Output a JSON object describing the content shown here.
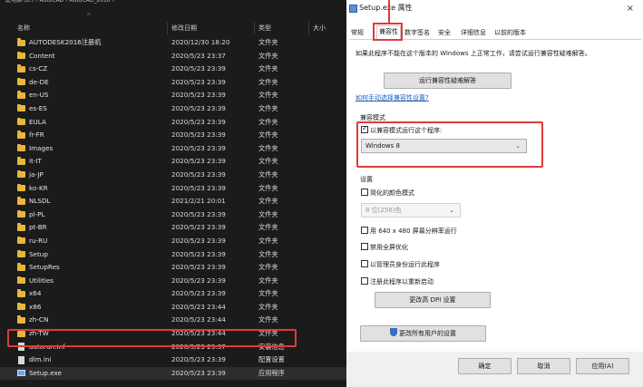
{
  "explorer": {
    "address_path": "此电脑 (D:) › AutoCAD › AutoCAD_2016 ›",
    "columns": {
      "name": "名称",
      "date": "修改日期",
      "type": "类型",
      "size": "大小"
    },
    "rows": [
      {
        "icon": "folder",
        "name": "AUTODESK2016注册机",
        "date": "2020/12/30 18:20",
        "type": "文件夹"
      },
      {
        "icon": "folder",
        "name": "Content",
        "date": "2020/5/23 23:37",
        "type": "文件夹"
      },
      {
        "icon": "folder",
        "name": "cs-CZ",
        "date": "2020/5/23 23:39",
        "type": "文件夹"
      },
      {
        "icon": "folder",
        "name": "de-DE",
        "date": "2020/5/23 23:39",
        "type": "文件夹"
      },
      {
        "icon": "folder",
        "name": "en-US",
        "date": "2020/5/23 23:39",
        "type": "文件夹"
      },
      {
        "icon": "folder",
        "name": "es-ES",
        "date": "2020/5/23 23:39",
        "type": "文件夹"
      },
      {
        "icon": "folder",
        "name": "EULA",
        "date": "2020/5/23 23:39",
        "type": "文件夹"
      },
      {
        "icon": "folder",
        "name": "fr-FR",
        "date": "2020/5/23 23:39",
        "type": "文件夹"
      },
      {
        "icon": "folder",
        "name": "Images",
        "date": "2020/5/23 23:39",
        "type": "文件夹"
      },
      {
        "icon": "folder",
        "name": "it-IT",
        "date": "2020/5/23 23:39",
        "type": "文件夹"
      },
      {
        "icon": "folder",
        "name": "ja-JP",
        "date": "2020/5/23 23:39",
        "type": "文件夹"
      },
      {
        "icon": "folder",
        "name": "ko-KR",
        "date": "2020/5/23 23:39",
        "type": "文件夹"
      },
      {
        "icon": "folder",
        "name": "NLSDL",
        "date": "2021/2/21 20:01",
        "type": "文件夹"
      },
      {
        "icon": "folder",
        "name": "pl-PL",
        "date": "2020/5/23 23:39",
        "type": "文件夹"
      },
      {
        "icon": "folder",
        "name": "pt-BR",
        "date": "2020/5/23 23:39",
        "type": "文件夹"
      },
      {
        "icon": "folder",
        "name": "ru-RU",
        "date": "2020/5/23 23:39",
        "type": "文件夹"
      },
      {
        "icon": "folder",
        "name": "Setup",
        "date": "2020/5/23 23:39",
        "type": "文件夹"
      },
      {
        "icon": "folder",
        "name": "SetupRes",
        "date": "2020/5/23 23:39",
        "type": "文件夹"
      },
      {
        "icon": "folder",
        "name": "Utilities",
        "date": "2020/5/23 23:39",
        "type": "文件夹"
      },
      {
        "icon": "folder",
        "name": "x64",
        "date": "2020/5/23 23:39",
        "type": "文件夹"
      },
      {
        "icon": "folder",
        "name": "x86",
        "date": "2020/5/23 23:44",
        "type": "文件夹"
      },
      {
        "icon": "folder",
        "name": "zh-CN",
        "date": "2020/5/23 23:44",
        "type": "文件夹"
      },
      {
        "icon": "folder",
        "name": "zh-TW",
        "date": "2020/5/23 23:44",
        "type": "文件夹"
      },
      {
        "icon": "file",
        "name": "autorun.inf",
        "date": "2020/5/23 23:37",
        "type": "安装信息"
      },
      {
        "icon": "file",
        "name": "dlm.ini",
        "date": "2020/5/23 23:39",
        "type": "配置设置"
      },
      {
        "icon": "exe",
        "name": "Setup.exe",
        "date": "2020/5/23 23:39",
        "type": "应用程序",
        "selected": true
      }
    ]
  },
  "dialog": {
    "title": "Setup.exe 属性",
    "close_glyph": "×",
    "tabs": [
      "常规",
      "兼容性",
      "数字签名",
      "安全",
      "详细信息",
      "以前的版本"
    ],
    "active_tab": 1,
    "intro": "如果此程序不能在这个版本的 Windows 上正常工作，请尝试运行兼容性疑难解答。",
    "troubleshoot_button": "运行兼容性疑难解答",
    "manual_link": "如何手动选择兼容性设置?",
    "compat_group": {
      "label": "兼容模式",
      "checkbox_label": "以兼容模式运行这个程序:",
      "checked": true,
      "selected_os": "Windows 8"
    },
    "settings_group": {
      "label": "设置",
      "reduced_color_label": "简化的颜色模式",
      "color_mode_value": "8 位(256)色",
      "res_640_label": "用 640 x 480 屏幕分辨率运行",
      "disable_fullscreen_label": "禁用全屏优化",
      "run_as_admin_label": "以管理员身份运行此程序",
      "register_restart_label": "注册此程序以重新启动",
      "dpi_button": "更改高 DPI 设置"
    },
    "all_users_button": "更改所有用户的设置",
    "footer": {
      "ok": "确定",
      "cancel": "取消",
      "apply": "应用(A)"
    }
  },
  "colors": {
    "highlight_red": "#e03a3a",
    "folder_yellow": "#e8b739",
    "explorer_bg": "#1b1b1b"
  }
}
